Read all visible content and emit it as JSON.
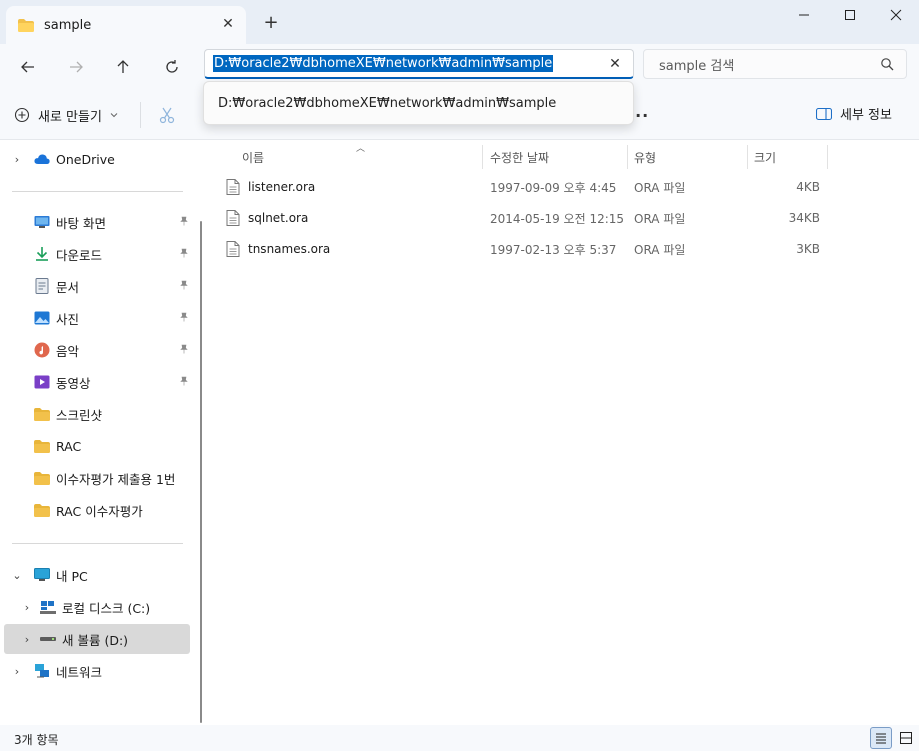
{
  "tab": {
    "label": "sample",
    "close": "✕",
    "new": "+"
  },
  "window": {
    "minimize": "—",
    "maximize": "☐",
    "close": "✕"
  },
  "address": {
    "value": "D:₩oracle2₩dbhomeXE₩network₩admin₩sample",
    "suggestion": "D:₩oracle2₩dbhomeXE₩network₩admin₩sample",
    "clear": "✕"
  },
  "search": {
    "placeholder": "sample 검색"
  },
  "toolbar": {
    "new_label": "새로 만들기",
    "more": "···",
    "details_label": "세부 정보"
  },
  "sidebar": {
    "onedrive": "OneDrive",
    "quick": [
      {
        "label": "바탕 화면",
        "icon": "desktop-icon",
        "color": "#2b7bd6"
      },
      {
        "label": "다운로드",
        "icon": "download-icon",
        "color": "#1b9f5a"
      },
      {
        "label": "문서",
        "icon": "document-icon",
        "color": "#6b7a8f"
      },
      {
        "label": "사진",
        "icon": "pictures-icon",
        "color": "#1e78d4"
      },
      {
        "label": "음악",
        "icon": "music-icon",
        "color": "#e0674d"
      },
      {
        "label": "동영상",
        "icon": "videos-icon",
        "color": "#7a3fc7"
      },
      {
        "label": "스크린샷",
        "icon": "folder-icon",
        "color": "#f2c14b"
      },
      {
        "label": "RAC",
        "icon": "folder-icon",
        "color": "#f2c14b"
      },
      {
        "label": "이수자평가 제출용 1번",
        "icon": "folder-icon",
        "color": "#f2c14b"
      },
      {
        "label": "RAC 이수자평가",
        "icon": "folder-icon",
        "color": "#f2c14b"
      }
    ],
    "pc": "내 PC",
    "drive_c": "로컬 디스크 (C:)",
    "drive_d": "새 볼륨 (D:)",
    "network": "네트워크"
  },
  "columns": {
    "name": "이름",
    "modified": "수정한 날짜",
    "type": "유형",
    "size": "크기"
  },
  "files": [
    {
      "name": "listener.ora",
      "modified": "1997-09-09 오후 4:45",
      "type": "ORA 파일",
      "size": "4KB"
    },
    {
      "name": "sqlnet.ora",
      "modified": "2014-05-19 오전 12:15",
      "type": "ORA 파일",
      "size": "34KB"
    },
    {
      "name": "tnsnames.ora",
      "modified": "1997-02-13 오후 5:37",
      "type": "ORA 파일",
      "size": "3KB"
    }
  ],
  "status": {
    "count": "3개 항목"
  },
  "colors": {
    "accent": "#0067c0",
    "selection": "#d9d9d9",
    "titlebar": "#e8eef6"
  }
}
